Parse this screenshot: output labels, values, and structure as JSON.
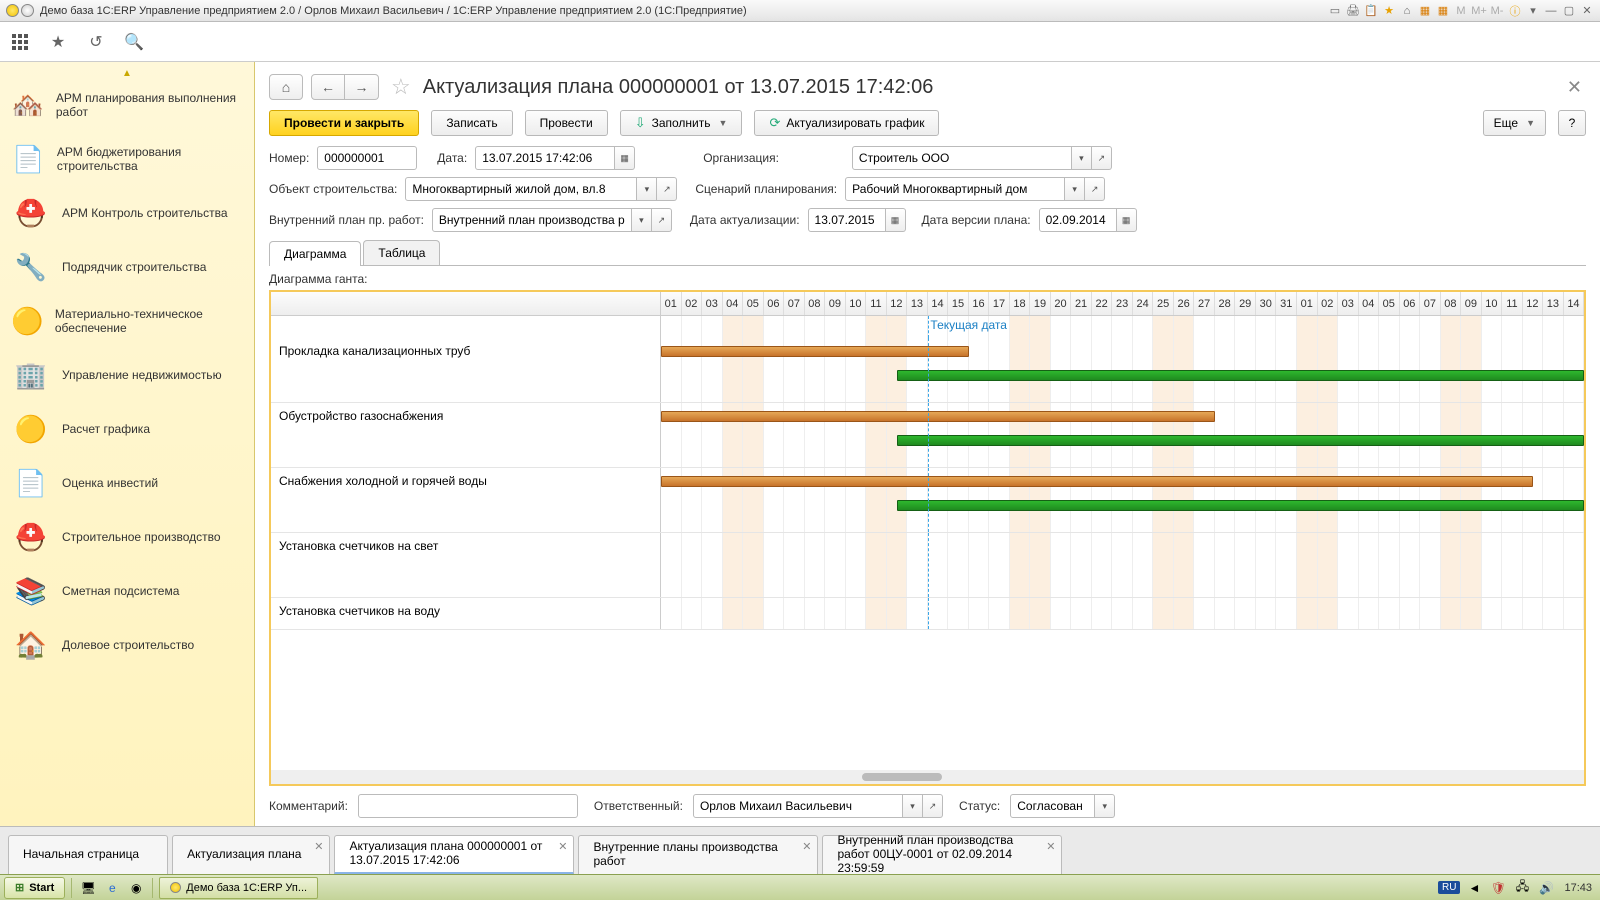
{
  "titlebar": {
    "text": "Демо база 1С:ERP Управление предприятием 2.0 / Орлов Михаил Васильевич / 1С:ERP Управление предприятием 2.0  (1С:Предприятие)",
    "m_labels": [
      "M",
      "M+",
      "M-"
    ]
  },
  "sidebar": {
    "items": [
      {
        "label": "АРМ планирования выполнения работ",
        "icon": "🏘️"
      },
      {
        "label": "АРМ бюджетирования строительства",
        "icon": "📄"
      },
      {
        "label": "АРМ Контроль строительства",
        "icon": "⛑️"
      },
      {
        "label": "Подрядчик строительства",
        "icon": "🔧"
      },
      {
        "label": "Материально-техническое обеспечение",
        "icon": "🟡"
      },
      {
        "label": "Управление недвижимостью",
        "icon": "🏢"
      },
      {
        "label": "Расчет графика",
        "icon": "🟡"
      },
      {
        "label": "Оценка инвестий",
        "icon": "📄"
      },
      {
        "label": "Строительное производство",
        "icon": "⛑️"
      },
      {
        "label": "Сметная подсистема",
        "icon": "📚"
      },
      {
        "label": "Долевое строительство",
        "icon": "🏠"
      }
    ]
  },
  "doc": {
    "title": "Актуализация плана 000000001 от 13.07.2015 17:42:06"
  },
  "toolbar": {
    "post_close": "Провести и закрыть",
    "save": "Записать",
    "post": "Провести",
    "fill": "Заполнить",
    "update_chart": "Актуализировать график",
    "more": "Еще",
    "help": "?"
  },
  "form": {
    "number_label": "Номер:",
    "number": "000000001",
    "date_label": "Дата:",
    "date": "13.07.2015 17:42:06",
    "org_label": "Организация:",
    "org": "Строитель ООО",
    "object_label": "Объект строительства:",
    "object": "Многоквартирный жилой дом, вл.8",
    "scenario_label": "Сценарий планирования:",
    "scenario": "Рабочий Многоквартирный дом",
    "inner_plan_label": "Внутренний план пр. работ:",
    "inner_plan": "Внутренний план производства работ №",
    "actual_date_label": "Дата актуализации:",
    "actual_date": "13.07.2015",
    "version_date_label": "Дата версии плана:",
    "version_date": "02.09.2014"
  },
  "tabs": {
    "diagram": "Диаграмма",
    "table": "Таблица"
  },
  "gantt": {
    "title": "Диаграмма ганта:",
    "today_label": "Текущая дата",
    "days": [
      "01",
      "02",
      "03",
      "04",
      "05",
      "06",
      "07",
      "08",
      "09",
      "10",
      "11",
      "12",
      "13",
      "14",
      "15",
      "16",
      "17",
      "18",
      "19",
      "20",
      "21",
      "22",
      "23",
      "24",
      "25",
      "26",
      "27",
      "28",
      "29",
      "30",
      "31",
      "01",
      "02",
      "03",
      "04",
      "05",
      "06",
      "07",
      "08",
      "09",
      "10",
      "11",
      "12",
      "13",
      "14"
    ],
    "weekend_idx": [
      3,
      4,
      10,
      11,
      17,
      18,
      24,
      25,
      31,
      32,
      38,
      39
    ],
    "today_idx": 13,
    "rows": [
      {
        "label": "Прокладка канализационных труб",
        "orange": [
          0,
          15
        ],
        "green": [
          11.5,
          45
        ]
      },
      {
        "label": "Обустройство газоснабжения",
        "orange": [
          0,
          27
        ],
        "green": [
          11.5,
          45
        ]
      },
      {
        "label": "Снабжения холодной и горячей воды",
        "orange": [
          0,
          42.5
        ],
        "green": [
          11.5,
          45
        ]
      },
      {
        "label": "Установка счетчиков на свет",
        "orange": null,
        "green": null
      },
      {
        "label": "Установка счетчиков на воду",
        "orange": null,
        "green": null,
        "half": true
      }
    ]
  },
  "footer": {
    "comment_label": "Комментарий:",
    "comment": "",
    "responsible_label": "Ответственный:",
    "responsible": "Орлов Михаил Васильевич",
    "status_label": "Статус:",
    "status": "Согласован"
  },
  "wintabs": [
    {
      "label": "Начальная страница",
      "closable": false
    },
    {
      "label": "Актуализация плана",
      "closable": true
    },
    {
      "label": "Актуализация плана 000000001 от 13.07.2015 17:42:06",
      "closable": true,
      "active": true
    },
    {
      "label": "Внутренние планы производства работ",
      "closable": true
    },
    {
      "label": "Внутренний план производства работ 00ЦУ-0001 от 02.09.2014 23:59:59",
      "closable": true
    }
  ],
  "taskbar": {
    "start": "Start",
    "app": "Демо база 1С:ERP Уп...",
    "lang": "RU",
    "time": "17:43"
  }
}
